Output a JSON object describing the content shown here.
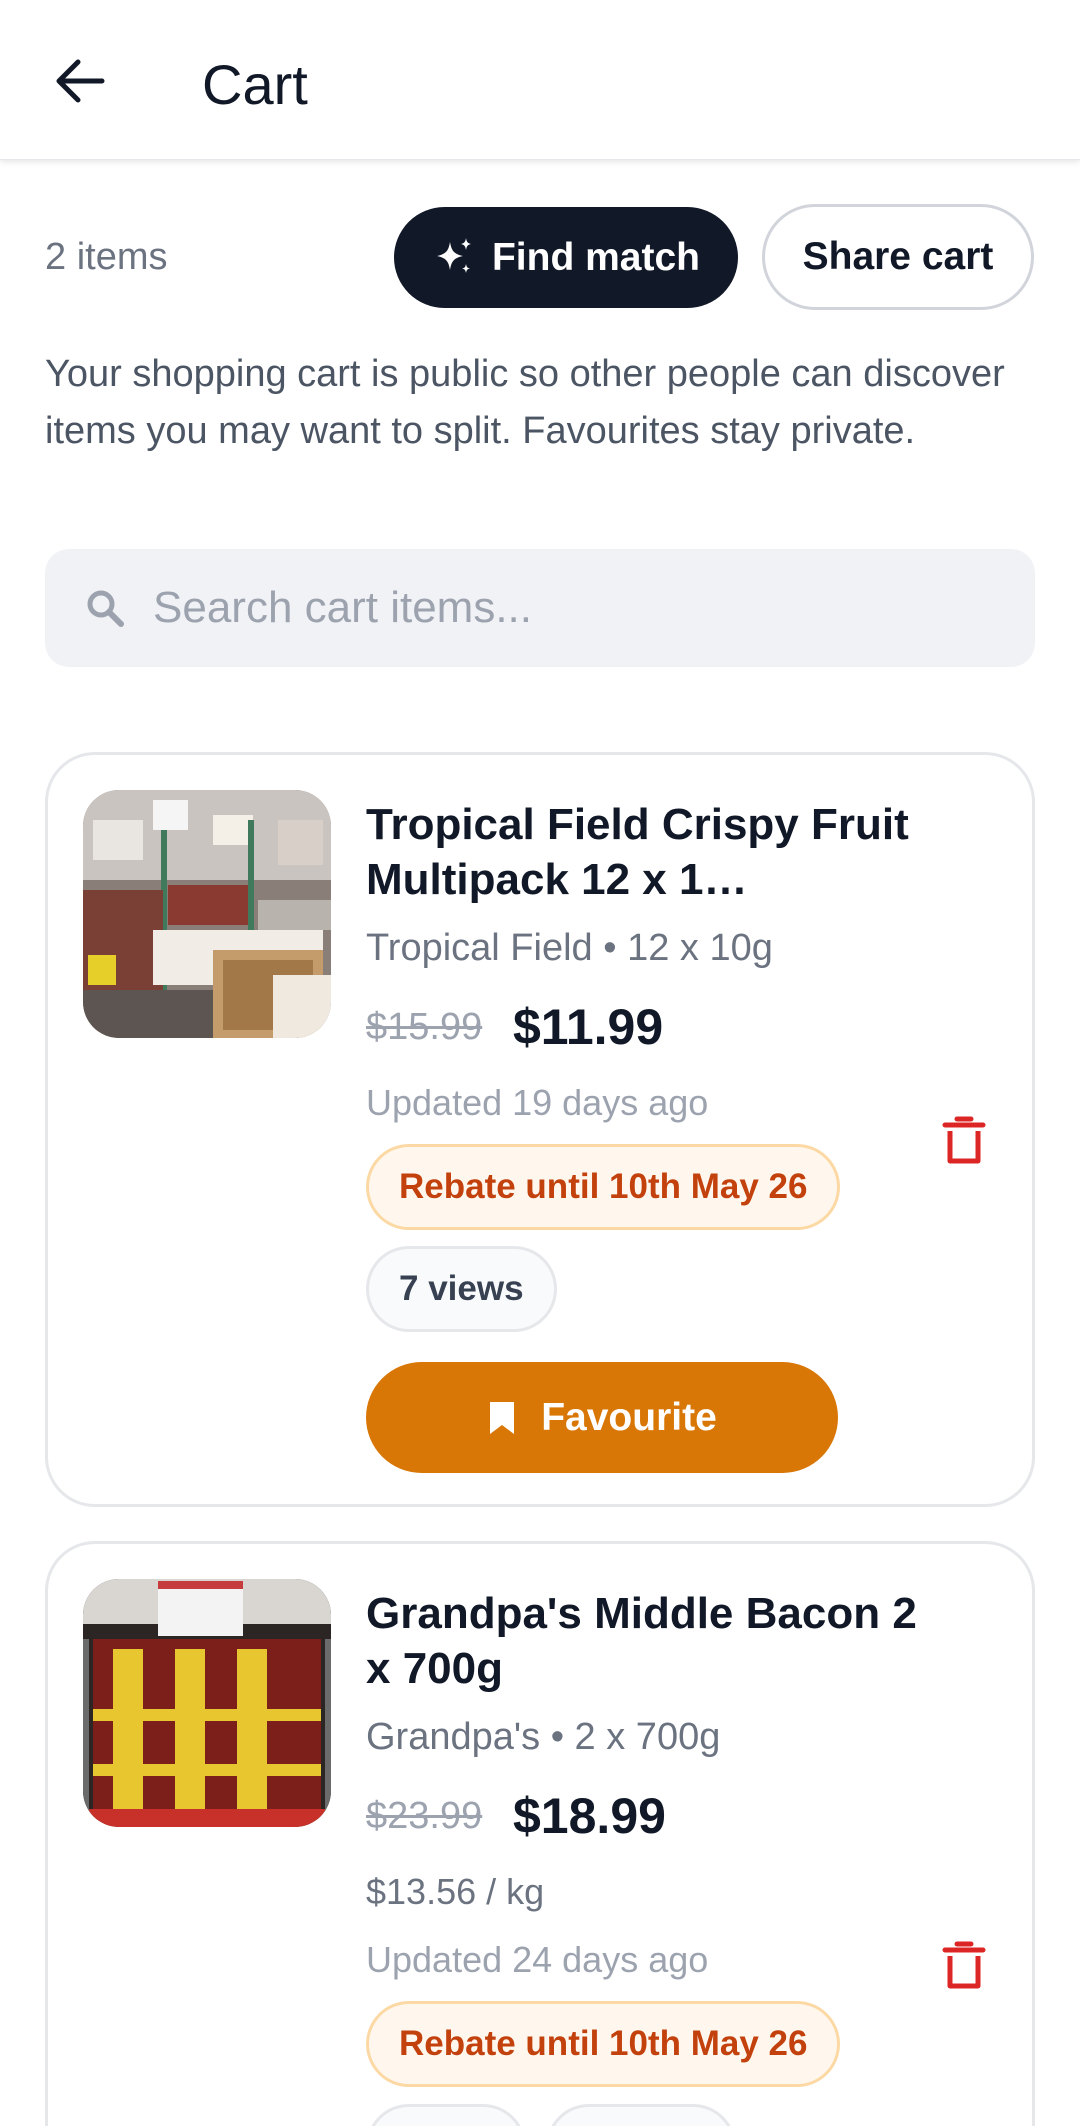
{
  "header": {
    "title": "Cart"
  },
  "toolbar": {
    "item_count": "2 items",
    "find_match_label": "Find match",
    "share_cart_label": "Share cart"
  },
  "notice": "Your shopping cart is public so other people can discover items you may want to split. Favourites stay private.",
  "search": {
    "placeholder": "Search cart items..."
  },
  "items": [
    {
      "name": "Tropical Field Crispy Fruit Multipack 12 x 1…",
      "brand_size": "Tropical Field • 12 x 10g",
      "old_price": "$15.99",
      "price": "$11.99",
      "updated": "Updated 19 days ago",
      "rebate": "Rebate until 10th May 26",
      "views": "7 views",
      "favourite_label": "Favourite"
    },
    {
      "name": "Grandpa's Middle Bacon 2 x 700g",
      "brand_size": "Grandpa's • 2 x 700g",
      "old_price": "$23.99",
      "price": "$18.99",
      "unit_price": "$13.56 / kg",
      "updated": "Updated 24 days ago",
      "rebate": "Rebate until 10th May 26"
    }
  ],
  "icons": {
    "back": "arrow-left-icon",
    "sparkle": "sparkle-icon",
    "search": "search-icon",
    "delete": "trash-icon",
    "bookmark": "bookmark-icon"
  },
  "colors": {
    "primary_dark": "#111827",
    "accent_orange": "#d97706",
    "rebate_text": "#c2410c",
    "delete_red": "#dc2626"
  }
}
